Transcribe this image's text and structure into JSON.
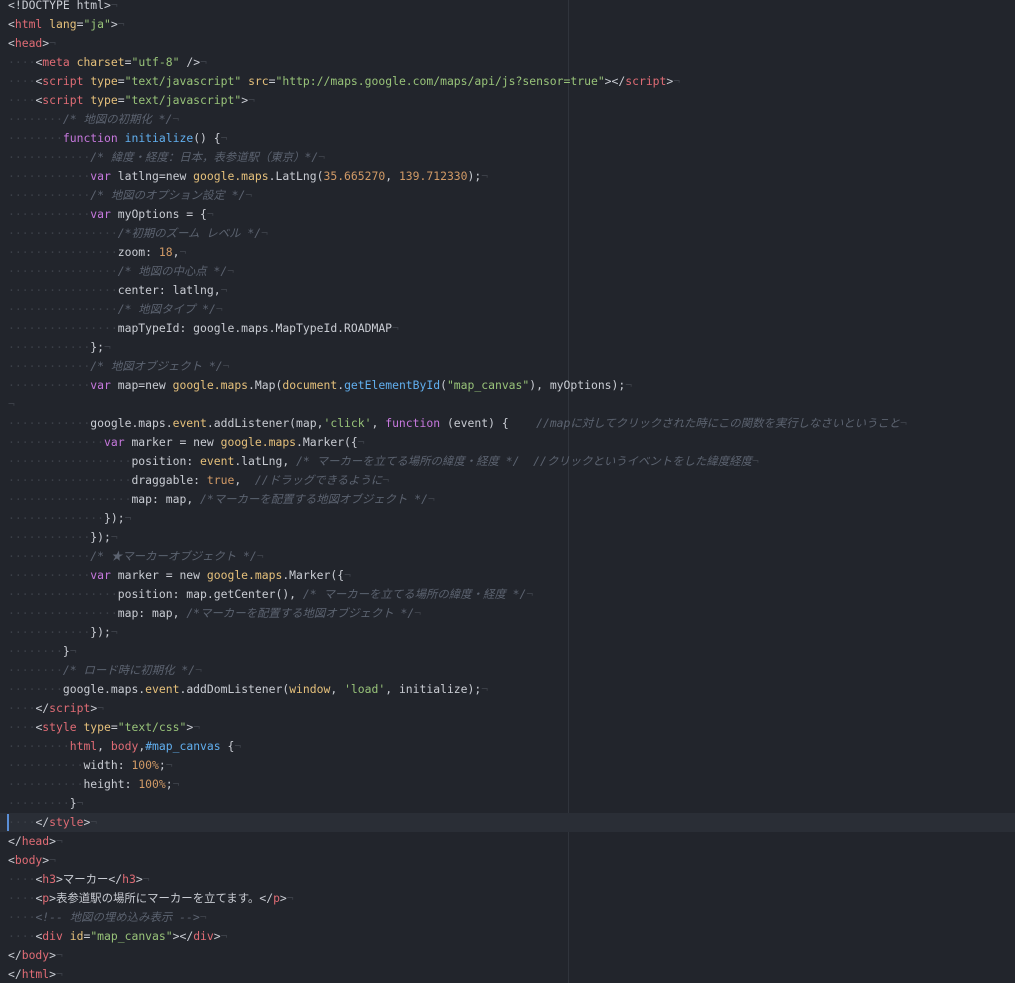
{
  "editor": {
    "language": "html",
    "active_line": 43,
    "colors": {
      "background": "#22252c",
      "tag": "#e06c75",
      "attribute": "#e5c07b",
      "string": "#98c379",
      "keyword": "#c678dd",
      "function": "#61afef",
      "object": "#e5c07b",
      "number": "#d19a66",
      "comment": "#5c6370",
      "whitespace": "#3b3f47",
      "text": "#c9ccd3"
    },
    "lines": [
      [
        [
          "txt",
          "<!DOCTYPE html>"
        ],
        [
          "ws",
          "¬"
        ]
      ],
      [
        [
          "txt",
          "<"
        ],
        [
          "tag",
          "html"
        ],
        [
          "txt",
          " "
        ],
        [
          "attr",
          "lang"
        ],
        [
          "txt",
          "="
        ],
        [
          "str",
          "\"ja\""
        ],
        [
          "txt",
          ">"
        ],
        [
          "ws",
          "¬"
        ]
      ],
      [
        [
          "txt",
          "<"
        ],
        [
          "tag",
          "head"
        ],
        [
          "txt",
          ">"
        ],
        [
          "ws",
          "¬"
        ]
      ],
      [
        [
          "ws",
          "····"
        ],
        [
          "txt",
          "<"
        ],
        [
          "tag",
          "meta"
        ],
        [
          "txt",
          " "
        ],
        [
          "attr",
          "charset"
        ],
        [
          "txt",
          "="
        ],
        [
          "str",
          "\"utf-8\""
        ],
        [
          "txt",
          " />"
        ],
        [
          "ws",
          "¬"
        ]
      ],
      [
        [
          "ws",
          "····"
        ],
        [
          "txt",
          "<"
        ],
        [
          "tag",
          "script"
        ],
        [
          "txt",
          " "
        ],
        [
          "attr",
          "type"
        ],
        [
          "txt",
          "="
        ],
        [
          "str",
          "\"text/javascript\""
        ],
        [
          "txt",
          " "
        ],
        [
          "attr",
          "src"
        ],
        [
          "txt",
          "="
        ],
        [
          "str",
          "\"http://maps.google.com/maps/api/js?sensor=true\""
        ],
        [
          "txt",
          "></"
        ],
        [
          "tag",
          "script"
        ],
        [
          "txt",
          ">"
        ],
        [
          "ws",
          "¬"
        ]
      ],
      [
        [
          "ws",
          "····"
        ],
        [
          "txt",
          "<"
        ],
        [
          "tag",
          "script"
        ],
        [
          "txt",
          " "
        ],
        [
          "attr",
          "type"
        ],
        [
          "txt",
          "="
        ],
        [
          "str",
          "\"text/javascript\""
        ],
        [
          "txt",
          ">"
        ],
        [
          "ws",
          "¬"
        ]
      ],
      [
        [
          "ws",
          "········"
        ],
        [
          "com",
          "/* 地図の初期化 */"
        ],
        [
          "ws",
          "¬"
        ]
      ],
      [
        [
          "ws",
          "········"
        ],
        [
          "kw",
          "function"
        ],
        [
          "txt",
          " "
        ],
        [
          "fn",
          "initialize"
        ],
        [
          "txt",
          "() {"
        ],
        [
          "ws",
          "¬"
        ]
      ],
      [
        [
          "ws",
          "············"
        ],
        [
          "com",
          "/* 緯度・経度：日本，表参道駅（東京）*/"
        ],
        [
          "ws",
          "¬"
        ]
      ],
      [
        [
          "ws",
          "············"
        ],
        [
          "kw",
          "var"
        ],
        [
          "txt",
          " latlng=new "
        ],
        [
          "obj",
          "google.maps"
        ],
        [
          "txt",
          ".LatLng("
        ],
        [
          "num",
          "35.665270"
        ],
        [
          "txt",
          ", "
        ],
        [
          "num",
          "139.712330"
        ],
        [
          "txt",
          ");"
        ],
        [
          "ws",
          "¬"
        ]
      ],
      [
        [
          "ws",
          "············"
        ],
        [
          "com",
          "/* 地図のオプション設定 */"
        ],
        [
          "ws",
          "¬"
        ]
      ],
      [
        [
          "ws",
          "············"
        ],
        [
          "kw",
          "var"
        ],
        [
          "txt",
          " myOptions = {"
        ],
        [
          "ws",
          "¬"
        ]
      ],
      [
        [
          "ws",
          "················"
        ],
        [
          "com",
          "/*初期のズーム レベル */"
        ],
        [
          "ws",
          "¬"
        ]
      ],
      [
        [
          "ws",
          "················"
        ],
        [
          "txt",
          "zoom: "
        ],
        [
          "num",
          "18"
        ],
        [
          "txt",
          ","
        ],
        [
          "ws",
          "¬"
        ]
      ],
      [
        [
          "ws",
          "················"
        ],
        [
          "com",
          "/* 地図の中心点 */"
        ],
        [
          "ws",
          "¬"
        ]
      ],
      [
        [
          "ws",
          "················"
        ],
        [
          "txt",
          "center: latlng,"
        ],
        [
          "ws",
          "¬"
        ]
      ],
      [
        [
          "ws",
          "················"
        ],
        [
          "com",
          "/* 地図タイプ */"
        ],
        [
          "ws",
          "¬"
        ]
      ],
      [
        [
          "ws",
          "················"
        ],
        [
          "txt",
          "mapTypeId: google.maps.MapTypeId.ROADMAP"
        ],
        [
          "ws",
          "¬"
        ]
      ],
      [
        [
          "ws",
          "············"
        ],
        [
          "txt",
          "};"
        ],
        [
          "ws",
          "¬"
        ]
      ],
      [
        [
          "ws",
          "············"
        ],
        [
          "com",
          "/* 地図オブジェクト */"
        ],
        [
          "ws",
          "¬"
        ]
      ],
      [
        [
          "ws",
          "············"
        ],
        [
          "kw",
          "var"
        ],
        [
          "txt",
          " map=new "
        ],
        [
          "obj",
          "google.maps"
        ],
        [
          "txt",
          ".Map("
        ],
        [
          "obj",
          "document"
        ],
        [
          "txt",
          "."
        ],
        [
          "fn",
          "getElementById"
        ],
        [
          "txt",
          "("
        ],
        [
          "str",
          "\"map_canvas\""
        ],
        [
          "txt",
          "), myOptions);"
        ],
        [
          "ws",
          "¬"
        ]
      ],
      [
        [
          "ws",
          "¬"
        ]
      ],
      [
        [
          "ws",
          "············"
        ],
        [
          "txt",
          "google.maps."
        ],
        [
          "obj",
          "event"
        ],
        [
          "txt",
          ".addListener(map,"
        ],
        [
          "str",
          "'click'"
        ],
        [
          "txt",
          ", "
        ],
        [
          "kw",
          "function"
        ],
        [
          "txt",
          " (event) {    "
        ],
        [
          "com",
          "//mapに対してクリックされた時にこの関数を実行しなさいということ"
        ],
        [
          "ws",
          "¬"
        ]
      ],
      [
        [
          "ws",
          "··············"
        ],
        [
          "kw",
          "var"
        ],
        [
          "txt",
          " marker = new "
        ],
        [
          "obj",
          "google.maps"
        ],
        [
          "txt",
          ".Marker({"
        ],
        [
          "ws",
          "¬"
        ]
      ],
      [
        [
          "ws",
          "··················"
        ],
        [
          "txt",
          "position: "
        ],
        [
          "obj",
          "event"
        ],
        [
          "txt",
          ".latLng, "
        ],
        [
          "com",
          "/* マーカーを立てる場所の緯度・経度 */  //クリックというイベントをした緯度経度"
        ],
        [
          "ws",
          "¬"
        ]
      ],
      [
        [
          "ws",
          "··················"
        ],
        [
          "txt",
          "draggable: "
        ],
        [
          "num",
          "true"
        ],
        [
          "txt",
          ",  "
        ],
        [
          "com",
          "//ドラッグできるように"
        ],
        [
          "ws",
          "¬"
        ]
      ],
      [
        [
          "ws",
          "··················"
        ],
        [
          "txt",
          "map: map, "
        ],
        [
          "com",
          "/*マーカーを配置する地図オブジェクト */"
        ],
        [
          "ws",
          "¬"
        ]
      ],
      [
        [
          "ws",
          "··············"
        ],
        [
          "txt",
          "});"
        ],
        [
          "ws",
          "¬"
        ]
      ],
      [
        [
          "ws",
          "············"
        ],
        [
          "txt",
          "});"
        ],
        [
          "ws",
          "¬"
        ]
      ],
      [
        [
          "ws",
          "············"
        ],
        [
          "com",
          "/* ★マーカーオブジェクト */"
        ],
        [
          "ws",
          "¬"
        ]
      ],
      [
        [
          "ws",
          "············"
        ],
        [
          "kw",
          "var"
        ],
        [
          "txt",
          " marker = new "
        ],
        [
          "obj",
          "google.maps"
        ],
        [
          "txt",
          ".Marker({"
        ],
        [
          "ws",
          "¬"
        ]
      ],
      [
        [
          "ws",
          "················"
        ],
        [
          "txt",
          "position: map.getCenter(), "
        ],
        [
          "com",
          "/* マーカーを立てる場所の緯度・経度 */"
        ],
        [
          "ws",
          "¬"
        ]
      ],
      [
        [
          "ws",
          "················"
        ],
        [
          "txt",
          "map: map, "
        ],
        [
          "com",
          "/*マーカーを配置する地図オブジェクト */"
        ],
        [
          "ws",
          "¬"
        ]
      ],
      [
        [
          "ws",
          "············"
        ],
        [
          "txt",
          "});"
        ],
        [
          "ws",
          "¬"
        ]
      ],
      [
        [
          "ws",
          "········"
        ],
        [
          "txt",
          "}"
        ],
        [
          "ws",
          "¬"
        ]
      ],
      [
        [
          "ws",
          "········"
        ],
        [
          "com",
          "/* ロード時に初期化 */"
        ],
        [
          "ws",
          "¬"
        ]
      ],
      [
        [
          "ws",
          "········"
        ],
        [
          "txt",
          "google.maps."
        ],
        [
          "obj",
          "event"
        ],
        [
          "txt",
          ".addDomListener("
        ],
        [
          "obj",
          "window"
        ],
        [
          "txt",
          ", "
        ],
        [
          "str",
          "'load'"
        ],
        [
          "txt",
          ", initialize);"
        ],
        [
          "ws",
          "¬"
        ]
      ],
      [
        [
          "ws",
          "····"
        ],
        [
          "txt",
          "</"
        ],
        [
          "tag",
          "script"
        ],
        [
          "txt",
          ">"
        ],
        [
          "ws",
          "¬"
        ]
      ],
      [
        [
          "ws",
          "····"
        ],
        [
          "txt",
          "<"
        ],
        [
          "tag",
          "style"
        ],
        [
          "txt",
          " "
        ],
        [
          "attr",
          "type"
        ],
        [
          "txt",
          "="
        ],
        [
          "str",
          "\"text/css\""
        ],
        [
          "txt",
          ">"
        ],
        [
          "ws",
          "¬"
        ]
      ],
      [
        [
          "ws",
          "·········"
        ],
        [
          "tag",
          "html"
        ],
        [
          "txt",
          ", "
        ],
        [
          "tag",
          "body"
        ],
        [
          "txt",
          ","
        ],
        [
          "fn",
          "#map_canvas"
        ],
        [
          "txt",
          " {"
        ],
        [
          "ws",
          "¬"
        ]
      ],
      [
        [
          "ws",
          "···········"
        ],
        [
          "txt",
          "width: "
        ],
        [
          "num",
          "100%"
        ],
        [
          "txt",
          ";"
        ],
        [
          "ws",
          "¬"
        ]
      ],
      [
        [
          "ws",
          "···········"
        ],
        [
          "txt",
          "height: "
        ],
        [
          "num",
          "100%"
        ],
        [
          "txt",
          ";"
        ],
        [
          "ws",
          "¬"
        ]
      ],
      [
        [
          "ws",
          "·········"
        ],
        [
          "txt",
          "}"
        ],
        [
          "ws",
          "¬"
        ]
      ],
      [
        [
          "ws",
          "····"
        ],
        [
          "txt",
          "</"
        ],
        [
          "tag",
          "style"
        ],
        [
          "txt",
          ">"
        ],
        [
          "ws",
          "¬"
        ]
      ],
      [
        [
          "txt",
          "</"
        ],
        [
          "tag",
          "head"
        ],
        [
          "txt",
          ">"
        ],
        [
          "ws",
          "¬"
        ]
      ],
      [
        [
          "txt",
          "<"
        ],
        [
          "tag",
          "body"
        ],
        [
          "txt",
          ">"
        ],
        [
          "ws",
          "¬"
        ]
      ],
      [
        [
          "ws",
          "····"
        ],
        [
          "txt",
          "<"
        ],
        [
          "tag",
          "h3"
        ],
        [
          "txt",
          ">マーカー</"
        ],
        [
          "tag",
          "h3"
        ],
        [
          "txt",
          ">"
        ],
        [
          "ws",
          "¬"
        ]
      ],
      [
        [
          "ws",
          "····"
        ],
        [
          "txt",
          "<"
        ],
        [
          "tag",
          "p"
        ],
        [
          "txt",
          ">表参道駅の場所にマーカーを立てます。</"
        ],
        [
          "tag",
          "p"
        ],
        [
          "txt",
          ">"
        ],
        [
          "ws",
          "¬"
        ]
      ],
      [
        [
          "ws",
          "····"
        ],
        [
          "com",
          "<!-- 地図の埋め込み表示 -->"
        ],
        [
          "ws",
          "¬"
        ]
      ],
      [
        [
          "ws",
          "····"
        ],
        [
          "txt",
          "<"
        ],
        [
          "tag",
          "div"
        ],
        [
          "txt",
          " "
        ],
        [
          "attr",
          "id"
        ],
        [
          "txt",
          "="
        ],
        [
          "str",
          "\"map_canvas\""
        ],
        [
          "txt",
          "></"
        ],
        [
          "tag",
          "div"
        ],
        [
          "txt",
          ">"
        ],
        [
          "ws",
          "¬"
        ]
      ],
      [
        [
          "txt",
          "</"
        ],
        [
          "tag",
          "body"
        ],
        [
          "txt",
          ">"
        ],
        [
          "ws",
          "¬"
        ]
      ],
      [
        [
          "txt",
          "</"
        ],
        [
          "tag",
          "html"
        ],
        [
          "txt",
          ">"
        ],
        [
          "ws",
          "¬"
        ]
      ]
    ]
  }
}
